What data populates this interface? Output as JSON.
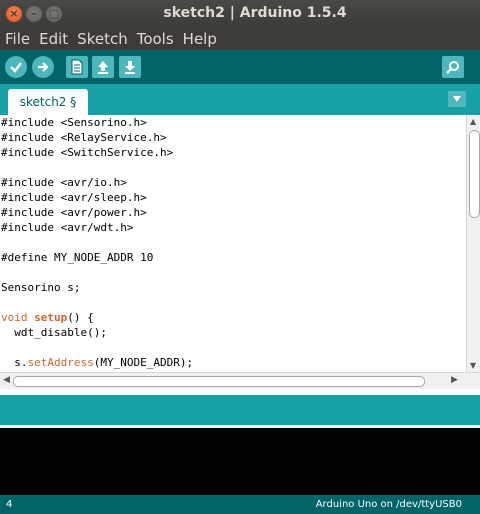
{
  "window": {
    "title": "sketch2 | Arduino 1.5.4",
    "close_glyph": "×",
    "minimize_glyph": "–",
    "maximize_glyph": "□"
  },
  "menu": [
    "File",
    "Edit",
    "Sketch",
    "Tools",
    "Help"
  ],
  "toolbar": {
    "buttons": [
      "verify-icon",
      "upload-icon",
      "new-icon",
      "open-icon",
      "save-icon"
    ],
    "serial_monitor_icon": "magnifier-icon"
  },
  "tabs": [
    {
      "label": "sketch2 §"
    }
  ],
  "editor": {
    "lines": [
      [
        {
          "t": "#include <Sensorino.h>"
        }
      ],
      [
        {
          "t": "#include <RelayService.h>"
        }
      ],
      [
        {
          "t": "#include <SwitchService.h>"
        }
      ],
      [
        {
          "t": ""
        }
      ],
      [
        {
          "t": "#include <avr/io.h>"
        }
      ],
      [
        {
          "t": "#include <avr/sleep.h>"
        }
      ],
      [
        {
          "t": "#include <avr/power.h>"
        }
      ],
      [
        {
          "t": "#include <avr/wdt.h>"
        }
      ],
      [
        {
          "t": ""
        }
      ],
      [
        {
          "t": "#define MY_NODE_ADDR 10"
        }
      ],
      [
        {
          "t": ""
        }
      ],
      [
        {
          "t": "Sensorino s;"
        }
      ],
      [
        {
          "t": ""
        }
      ],
      [
        {
          "t": "void",
          "c": "kw"
        },
        {
          "t": " "
        },
        {
          "t": "setup",
          "c": "fn"
        },
        {
          "t": "() {"
        }
      ],
      [
        {
          "t": "  wdt_disable();"
        }
      ],
      [
        {
          "t": ""
        }
      ],
      [
        {
          "t": "  s."
        },
        {
          "t": "setAddress",
          "c": "mt"
        },
        {
          "t": "(MY_NODE_ADDR);"
        }
      ]
    ]
  },
  "status": {
    "line_number": "4",
    "board": "Arduino Uno on /dev/ttyUSB0"
  },
  "colors": {
    "toolbar": "#006468",
    "tabbar": "#17a1a5",
    "button": "#4db7bb",
    "keyword": "#cc6633"
  }
}
